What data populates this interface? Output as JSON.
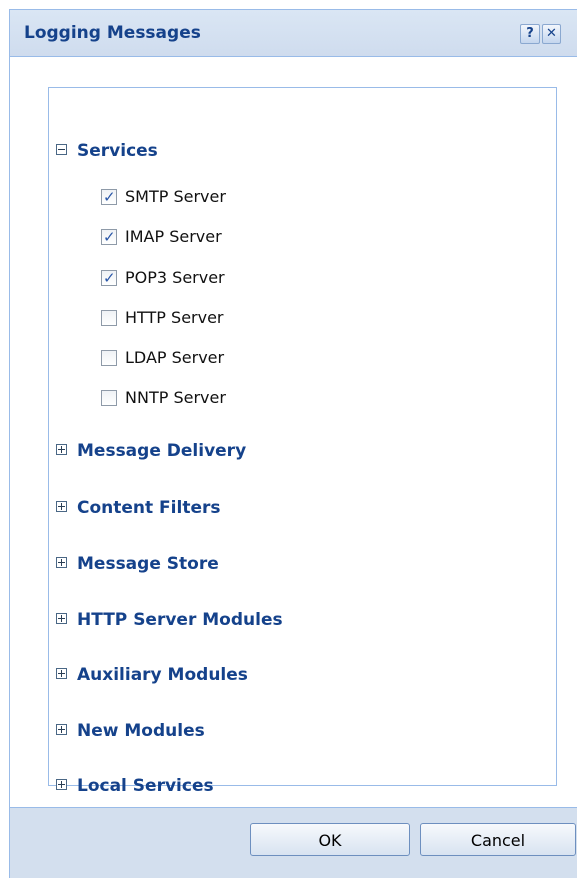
{
  "dialog": {
    "title": "Logging Messages",
    "help_glyph": "?",
    "close_glyph": "✕"
  },
  "groups": [
    {
      "label": "Services",
      "expanded": true,
      "items": [
        {
          "label": "SMTP Server",
          "checked": true
        },
        {
          "label": "IMAP Server",
          "checked": true
        },
        {
          "label": "POP3 Server",
          "checked": true
        },
        {
          "label": "HTTP Server",
          "checked": false
        },
        {
          "label": "LDAP Server",
          "checked": false
        },
        {
          "label": "NNTP Server",
          "checked": false
        }
      ]
    },
    {
      "label": "Message Delivery",
      "expanded": false
    },
    {
      "label": "Content Filters",
      "expanded": false
    },
    {
      "label": "Message Store",
      "expanded": false
    },
    {
      "label": "HTTP Server Modules",
      "expanded": false
    },
    {
      "label": "Auxiliary Modules",
      "expanded": false
    },
    {
      "label": "New Modules",
      "expanded": false
    },
    {
      "label": "Local Services",
      "expanded": false
    }
  ],
  "buttons": {
    "ok": "OK",
    "cancel": "Cancel"
  }
}
